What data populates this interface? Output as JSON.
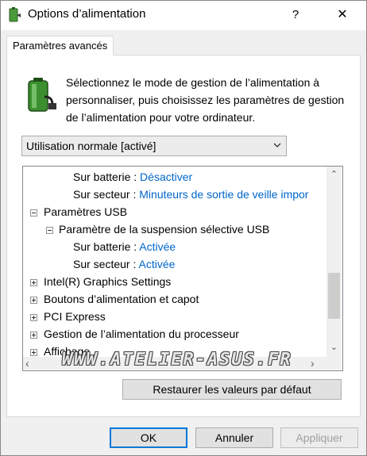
{
  "window": {
    "title": "Options d’alimentation",
    "help_label": "?",
    "close_label": "✕"
  },
  "tab": {
    "label": "Paramètres avancés"
  },
  "description": "Sélectionnez le mode de gestion de l’alimentation à personnaliser, puis choisissez les paramètres de gestion de l’alimentation pour votre ordinateur.",
  "plan_select": {
    "value": "Utilisation normale [activé]"
  },
  "tree": {
    "rows": [
      {
        "label": "Sur batterie :",
        "value": "Désactiver"
      },
      {
        "label": "Sur secteur :",
        "value": "Minuteurs de sortie de veille impor"
      },
      {
        "label": "Paramètres USB"
      },
      {
        "label": "Paramètre de la suspension sélective USB"
      },
      {
        "label": "Sur batterie :",
        "value": "Activée"
      },
      {
        "label": "Sur secteur :",
        "value": "Activée"
      },
      {
        "label": "Intel(R) Graphics Settings"
      },
      {
        "label": "Boutons d’alimentation et capot"
      },
      {
        "label": "PCI Express"
      },
      {
        "label": "Gestion de l’alimentation du processeur"
      },
      {
        "label": "Affichage"
      }
    ]
  },
  "watermark": "WWW.ATELIER-ASUS.FR",
  "buttons": {
    "restore": "Restaurer les valeurs par défaut",
    "ok": "OK",
    "cancel": "Annuler",
    "apply": "Appliquer"
  },
  "colors": {
    "link": "#0066cc",
    "accent": "#0078d7"
  },
  "icons": [
    "power-options-icon",
    "battery-icon",
    "chevron-down-icon",
    "expand-icon",
    "collapse-icon",
    "scroll-up-icon",
    "scroll-down-icon",
    "scroll-left-icon",
    "scroll-right-icon"
  ]
}
